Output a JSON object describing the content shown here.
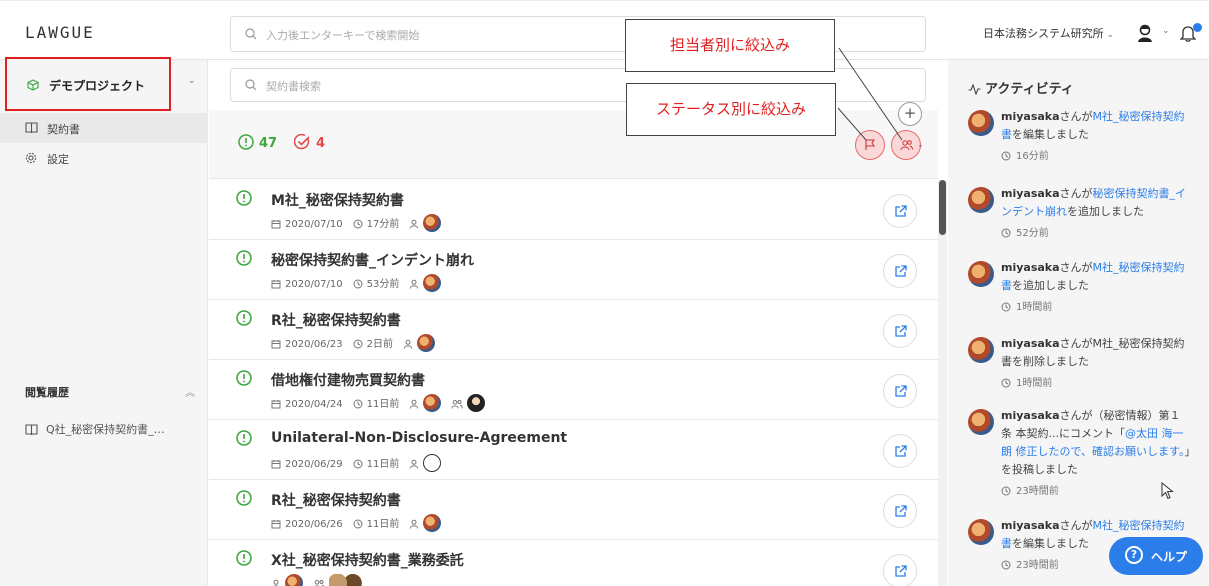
{
  "header": {
    "logo": "LAWGUE",
    "search_placeholder": "入力後エンターキーで検索開始",
    "organization": "日本法務システム研究所",
    "chevron": "⌄"
  },
  "sidebar": {
    "project_label": "デモプロジェクト",
    "chevron": "⌄",
    "items": [
      {
        "label": "契約書",
        "icon": "book-icon"
      },
      {
        "label": "設定",
        "icon": "gear-icon"
      }
    ],
    "history_title": "閲覧履歴",
    "history_toggle": "︽",
    "history_items": [
      {
        "label": "Q社_秘密保持契約書_…"
      }
    ]
  },
  "main": {
    "contract_search_placeholder": "契約書検索",
    "stats": {
      "open_count": "47",
      "done_count": "4"
    },
    "add_label": "+",
    "filter_chevron": "⌄",
    "contracts": [
      {
        "title": "M社_秘密保持契約書",
        "date": "2020/07/10",
        "ago": "17分前",
        "assignees": [
          "photo"
        ],
        "watchers": []
      },
      {
        "title": "秘密保持契約書_インデント崩れ",
        "date": "2020/07/10",
        "ago": "53分前",
        "assignees": [
          "photo"
        ],
        "watchers": []
      },
      {
        "title": "R社_秘密保持契約書",
        "date": "2020/06/23",
        "ago": "2日前",
        "assignees": [
          "photo"
        ],
        "watchers": []
      },
      {
        "title": "借地権付建物売買契約書",
        "date": "2020/04/24",
        "ago": "11日前",
        "assignees": [
          "photo"
        ],
        "watchers": [
          "dark"
        ]
      },
      {
        "title": "Unilateral-Non-Disclosure-Agreement",
        "date": "2020/06/29",
        "ago": "11日前",
        "assignees": [
          "line"
        ],
        "watchers": []
      },
      {
        "title": "R社_秘密保持契約書",
        "date": "2020/06/26",
        "ago": "11日前",
        "assignees": [
          "photo"
        ],
        "watchers": []
      },
      {
        "title": "X社_秘密保持契約書_業務委託",
        "date": "",
        "ago": "",
        "assignees": [
          "photo"
        ],
        "watchers": [
          "group"
        ]
      }
    ]
  },
  "activity": {
    "title": "アクティビティ",
    "items": [
      {
        "user": "miyasaka",
        "pre": "さんが",
        "link": "M社_秘密保持契約書",
        "post": "を編集しました",
        "time": "16分前"
      },
      {
        "user": "miyasaka",
        "pre": "さんが",
        "link": "秘密保持契約書_インデント崩れ",
        "post": "を追加しました",
        "time": "52分前"
      },
      {
        "user": "miyasaka",
        "pre": "さんが",
        "link": "M社_秘密保持契約書",
        "post": "を追加しました",
        "time": "1時間前"
      },
      {
        "user": "miyasaka",
        "pre": "さんがM社_秘密保持契約書を削除しました",
        "link": "",
        "post": "",
        "time": "1時間前"
      },
      {
        "user": "miyasaka",
        "pre": "さんが（秘密情報）第１条 本契約...にコメント「",
        "link": "@太田 海一朗 修正したので、確認お願いします。",
        "post": "」を投稿しました",
        "time": "23時間前"
      },
      {
        "user": "miyasaka",
        "pre": "さんが",
        "link": "M社_秘密保持契約書",
        "post": "を編集しました",
        "time": "23時間前"
      }
    ]
  },
  "help": {
    "label": "ヘルプ",
    "icon_glyph": "?"
  },
  "callouts": {
    "assignee": "担当者別に絞込み",
    "status": "ステータス別に絞込み"
  },
  "colors": {
    "accent": "#2b7de9",
    "open": "#3aa83a",
    "done": "#e24a4a",
    "annotation": "#e02020"
  }
}
